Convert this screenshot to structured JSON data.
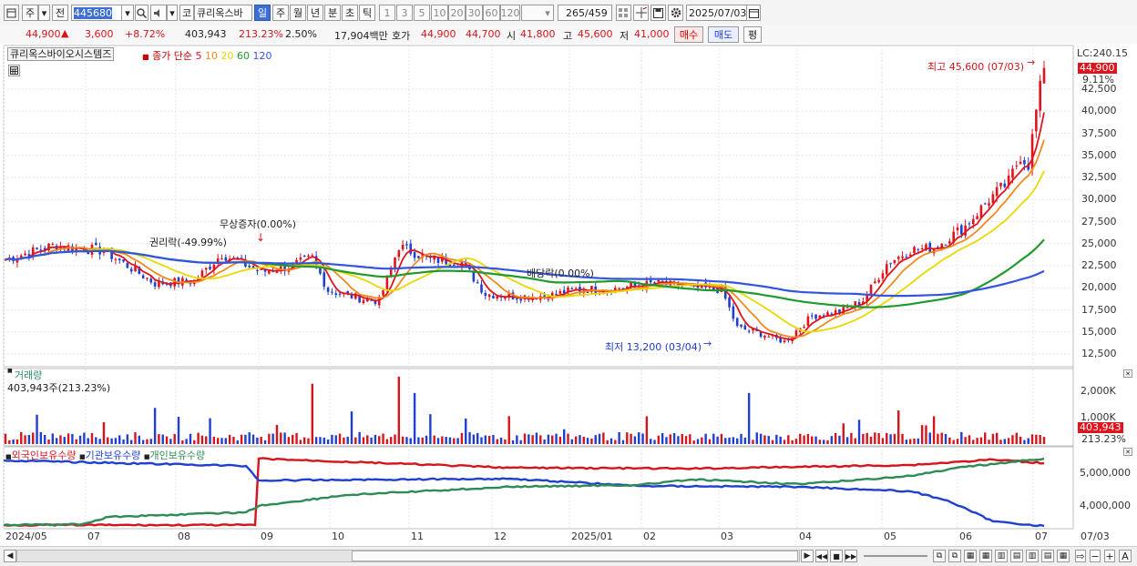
{
  "toolbar": {
    "market": "주",
    "prev": "전",
    "code": "445680",
    "ko": "코",
    "stock_name": "큐리옥스바",
    "periods": [
      "일",
      "주",
      "월",
      "년",
      "분",
      "초",
      "틱"
    ],
    "intervals": [
      "1",
      "3",
      "5",
      "10",
      "20",
      "30",
      "60",
      "120"
    ],
    "count": "265",
    "count_total": "/459",
    "date": "2025/07/03"
  },
  "quote": {
    "price": "44,900",
    "change": "3,600",
    "change_pct": "+8.72%",
    "volume": "403,943",
    "vol_ratio": "213.23%",
    "turnover": "2.50%",
    "amount": "17,904백만",
    "hoga_label": "호가",
    "ask": "44,900",
    "bid": "44,700",
    "open_label": "시",
    "open": "41,800",
    "high_label": "고",
    "high": "45,600",
    "low_label": "저",
    "low": "41,000",
    "buy_label": "매수",
    "sell_label": "매도",
    "eval_label": "평"
  },
  "price_panel": {
    "title": "큐리옥스바이오시스템즈",
    "ma_label": "종가 단순",
    "ma_periods": [
      {
        "label": "5",
        "color": "#e0141c"
      },
      {
        "label": "10",
        "color": "#f08a1c"
      },
      {
        "label": "20",
        "color": "#e8d800"
      },
      {
        "label": "60",
        "color": "#1f9a2e"
      },
      {
        "label": "120",
        "color": "#3355dd"
      }
    ],
    "lc": "LC:240.15",
    "current": "44,900",
    "pct": "9.11%",
    "y_ticks": [
      "42,500",
      "40,000",
      "37,500",
      "35,000",
      "32,500",
      "30,000",
      "27,500",
      "25,000",
      "22,500",
      "20,000",
      "17,500",
      "15,000",
      "12,500"
    ],
    "annotations": {
      "high": "최고 45,600 (07/03)",
      "low": "최저 13,200 (03/04)",
      "bonus": "무상증자(0.00%)",
      "rights": "권리락(-49.99%)",
      "dividend": "배당락(0.00%)"
    }
  },
  "volume_panel": {
    "title": "거래량",
    "value": "403,943주(213.23%)",
    "y_ticks": [
      "2,000K",
      "1,000K"
    ],
    "current": "403,943",
    "pct": "213.23%"
  },
  "holding_panel": {
    "legend": [
      {
        "label": "외국인보유수량",
        "color": "#d6141c"
      },
      {
        "label": "기관보유수량",
        "color": "#1f3fd0"
      },
      {
        "label": "개인보유수량",
        "color": "#2e8b57"
      }
    ],
    "y_ticks": [
      "5,000,000",
      "4,000,000"
    ]
  },
  "x_axis": [
    "2024/05",
    "07",
    "08",
    "09",
    "10",
    "11",
    "12",
    "2025/01",
    "02",
    "03",
    "04",
    "05",
    "06",
    "07"
  ],
  "x_axis_end": "07/03"
}
